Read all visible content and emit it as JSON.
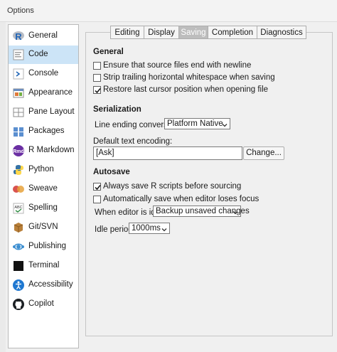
{
  "window": {
    "title": "Options"
  },
  "sidebar": {
    "items": [
      {
        "label": "General",
        "icon": "r-logo-icon"
      },
      {
        "label": "Code",
        "icon": "code-icon",
        "selected": true
      },
      {
        "label": "Console",
        "icon": "console-icon"
      },
      {
        "label": "Appearance",
        "icon": "appearance-icon"
      },
      {
        "label": "Pane Layout",
        "icon": "pane-layout-icon"
      },
      {
        "label": "Packages",
        "icon": "packages-icon"
      },
      {
        "label": "R Markdown",
        "icon": "rmarkdown-icon"
      },
      {
        "label": "Python",
        "icon": "python-icon"
      },
      {
        "label": "Sweave",
        "icon": "sweave-icon"
      },
      {
        "label": "Spelling",
        "icon": "spelling-icon"
      },
      {
        "label": "Git/SVN",
        "icon": "git-svn-icon"
      },
      {
        "label": "Publishing",
        "icon": "publishing-icon"
      },
      {
        "label": "Terminal",
        "icon": "terminal-icon"
      },
      {
        "label": "Accessibility",
        "icon": "accessibility-icon"
      },
      {
        "label": "Copilot",
        "icon": "github-icon"
      }
    ]
  },
  "tabs": [
    {
      "label": "Editing"
    },
    {
      "label": "Display"
    },
    {
      "label": "Saving",
      "active": true
    },
    {
      "label": "Completion"
    },
    {
      "label": "Diagnostics"
    }
  ],
  "general": {
    "heading": "General",
    "ensure_newline": {
      "label": "Ensure that source files end with newline",
      "checked": false
    },
    "strip_whitespace": {
      "label": "Strip trailing horizontal whitespace when saving",
      "checked": false
    },
    "restore_cursor": {
      "label": "Restore last cursor position when opening file",
      "checked": true
    }
  },
  "serialization": {
    "heading": "Serialization",
    "line_ending_label": "Line ending conversion:",
    "line_ending_value": "Platform Native",
    "encoding_label": "Default text encoding:",
    "encoding_value": "[Ask]",
    "change_button": "Change..."
  },
  "autosave": {
    "heading": "Autosave",
    "save_before_sourcing": {
      "label": "Always save R scripts before sourcing",
      "checked": true
    },
    "save_on_focus_loss": {
      "label": "Automatically save when editor loses focus",
      "checked": false
    },
    "idle_label": "When editor is idle:",
    "idle_value": "Backup unsaved changes",
    "period_label": "Idle period:",
    "period_value": "1000ms"
  },
  "colors": {
    "selection": "#cce4f7",
    "active_tab": "#bdbdbd",
    "r_blue": "#2165b6",
    "python_blue": "#3572a5",
    "python_yellow": "#ffd43b",
    "rmarkdown_purple": "#6b2fa3",
    "publishing_blue": "#3d8fd1"
  }
}
